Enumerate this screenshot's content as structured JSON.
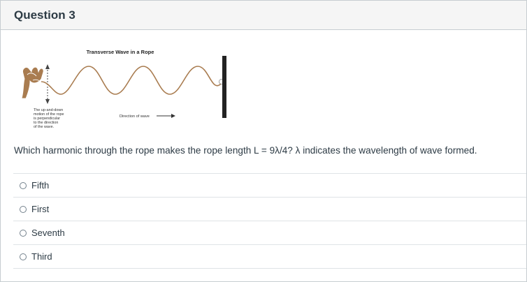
{
  "question": {
    "title": "Question 3",
    "figure": {
      "title": "Transverse Wave in a Rope",
      "motion_note": [
        "The up-and-down",
        "motion of the rope",
        "is perpendicular",
        "to the direction",
        "of the wave."
      ],
      "direction_label": "Direction of wave"
    },
    "prompt": "Which harmonic through the rope makes the rope length L = 9λ/4? λ indicates the wavelength of wave formed.",
    "answers": [
      {
        "label": "Fifth"
      },
      {
        "label": "First"
      },
      {
        "label": "Seventh"
      },
      {
        "label": "Third"
      }
    ]
  },
  "colors": {
    "rope": "#a97c50",
    "hand": "#a97c50",
    "wall": "#222222",
    "border": "#c7cdd1"
  },
  "icons": [
    "hand-icon",
    "up-down-arrow-icon",
    "direction-arrow-icon",
    "radio-icon"
  ]
}
